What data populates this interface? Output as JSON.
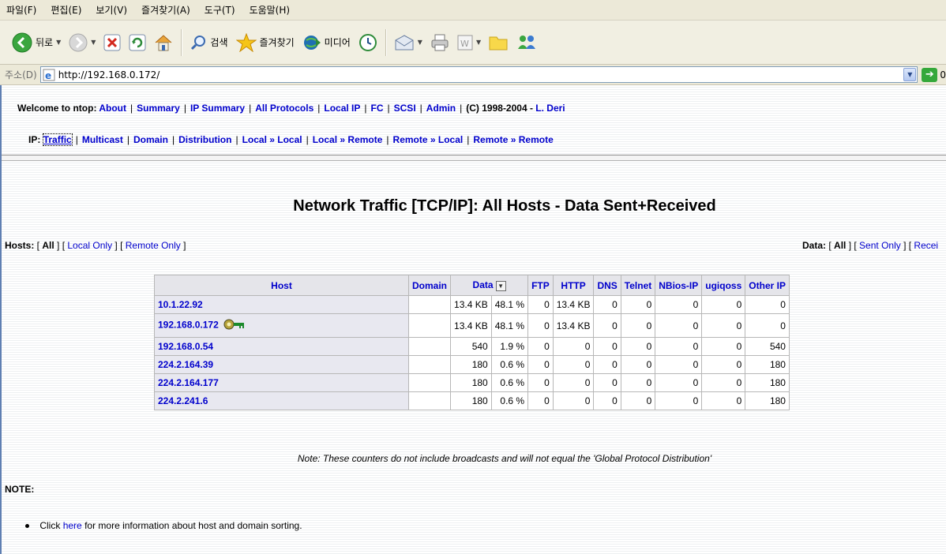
{
  "browser": {
    "menu": [
      "파일(F)",
      "편집(E)",
      "보기(V)",
      "즐겨찾기(A)",
      "도구(T)",
      "도움말(H)"
    ],
    "toolbar": {
      "back": "뒤로",
      "search": "검색",
      "favorites": "즐겨찾기",
      "media": "미디어"
    },
    "address": {
      "label": "주소(D)",
      "url": "http://192.168.0.172/",
      "go": "0"
    }
  },
  "nav": {
    "welcome": "Welcome to ntop:",
    "links": [
      "About",
      "Summary",
      "IP Summary",
      "All Protocols",
      "Local IP",
      "FC",
      "SCSI",
      "Admin"
    ],
    "copyright": "(C) 1998-2004 - ",
    "author": "L. Deri",
    "ip_label": "IP:",
    "ip_links": [
      "Traffic",
      "Multicast",
      "Domain",
      "Distribution",
      "Local » Local",
      "Local » Remote",
      "Remote » Local",
      "Remote » Remote"
    ]
  },
  "page": {
    "title": "Network Traffic [TCP/IP]: All Hosts - Data Sent+Received",
    "hosts_filter": {
      "label": "Hosts:",
      "all": "All",
      "local": "Local Only",
      "remote": "Remote Only"
    },
    "data_filter": {
      "label": "Data:",
      "all": "All",
      "sent": "Sent Only",
      "received": "Recei"
    }
  },
  "table": {
    "headers": [
      "Host",
      "Domain",
      "Data",
      "FTP",
      "HTTP",
      "DNS",
      "Telnet",
      "NBios-IP",
      "ugiqoss",
      "Other IP"
    ],
    "rows": [
      {
        "host": "10.1.22.92",
        "domain": "",
        "data": "13.4 KB",
        "pct": "48.1 %",
        "ftp": "0",
        "http": "13.4 KB",
        "dns": "0",
        "telnet": "0",
        "nbios": "0",
        "ugiqoss": "0",
        "other": "0"
      },
      {
        "host": "192.168.0.172",
        "domain": "",
        "data": "13.4 KB",
        "pct": "48.1 %",
        "ftp": "0",
        "http": "13.4 KB",
        "dns": "0",
        "telnet": "0",
        "nbios": "0",
        "ugiqoss": "0",
        "other": "0"
      },
      {
        "host": "192.168.0.54",
        "domain": "",
        "data": "540",
        "pct": "1.9 %",
        "ftp": "0",
        "http": "0",
        "dns": "0",
        "telnet": "0",
        "nbios": "0",
        "ugiqoss": "0",
        "other": "540"
      },
      {
        "host": "224.2.164.39",
        "domain": "",
        "data": "180",
        "pct": "0.6 %",
        "ftp": "0",
        "http": "0",
        "dns": "0",
        "telnet": "0",
        "nbios": "0",
        "ugiqoss": "0",
        "other": "180"
      },
      {
        "host": "224.2.164.177",
        "domain": "",
        "data": "180",
        "pct": "0.6 %",
        "ftp": "0",
        "http": "0",
        "dns": "0",
        "telnet": "0",
        "nbios": "0",
        "ugiqoss": "0",
        "other": "180"
      },
      {
        "host": "224.2.241.6",
        "domain": "",
        "data": "180",
        "pct": "0.6 %",
        "ftp": "0",
        "http": "0",
        "dns": "0",
        "telnet": "0",
        "nbios": "0",
        "ugiqoss": "0",
        "other": "180"
      }
    ]
  },
  "footer": {
    "note": "Note: These counters do not include broadcasts and will not equal the 'Global Protocol Distribution'",
    "note_label": "NOTE:",
    "click": "Click",
    "here": "here",
    "rest": "for more information about host and domain sorting."
  },
  "icons": {
    "back": "back-arrow-icon",
    "forward": "forward-arrow-icon",
    "stop": "stop-icon",
    "refresh": "refresh-icon",
    "home": "home-icon",
    "search": "search-icon",
    "favorites": "star-icon",
    "media": "media-icon",
    "history": "history-icon",
    "mail": "mail-icon",
    "print": "print-icon",
    "edit": "edit-icon",
    "discuss": "folder-icon",
    "messenger": "messenger-icon",
    "key": "key-icon"
  },
  "colors": {
    "link": "#0000cc",
    "header_bg": "#e5e5ea",
    "host_bg": "#e8e8f0",
    "go": "#34a83a"
  }
}
